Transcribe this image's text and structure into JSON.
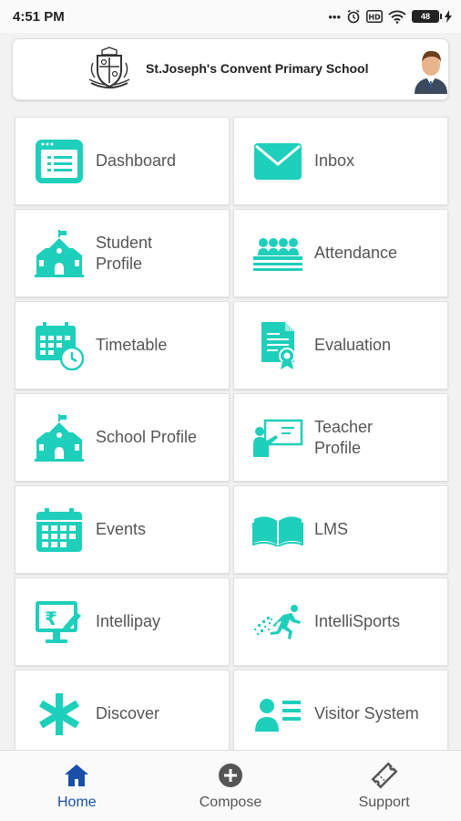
{
  "status_bar": {
    "time": "4:51 PM",
    "battery": "48",
    "icons": [
      "dots-icon",
      "alarm-icon",
      "hd-icon",
      "wifi-icon",
      "battery-icon",
      "charging-icon"
    ]
  },
  "header": {
    "school_name": "St.Joseph's Convent Primary School",
    "logo": "school-crest-icon",
    "avatar": "user-avatar-icon"
  },
  "colors": {
    "accent": "#1ecfbb",
    "nav_active": "#1a4fa8",
    "text": "#555555"
  },
  "tiles": [
    {
      "label": "Dashboard",
      "icon": "dashboard-icon"
    },
    {
      "label": "Inbox",
      "icon": "envelope-icon"
    },
    {
      "label": "Student\nProfile",
      "icon": "school-building-icon"
    },
    {
      "label": "Attendance",
      "icon": "classroom-icon"
    },
    {
      "label": "Timetable",
      "icon": "calendar-clock-icon"
    },
    {
      "label": "Evaluation",
      "icon": "certificate-icon"
    },
    {
      "label": "School Profile",
      "icon": "school-building-icon"
    },
    {
      "label": "Teacher\nProfile",
      "icon": "teacher-board-icon"
    },
    {
      "label": "Events",
      "icon": "calendar-icon"
    },
    {
      "label": "LMS",
      "icon": "open-book-icon"
    },
    {
      "label": "Intellipay",
      "icon": "rupee-monitor-icon"
    },
    {
      "label": "IntelliSports",
      "icon": "runner-icon"
    },
    {
      "label": "Discover",
      "icon": "asterisk-icon"
    },
    {
      "label": "Visitor System",
      "icon": "visitor-card-icon"
    }
  ],
  "bottom_nav": [
    {
      "label": "Home",
      "icon": "home-icon",
      "active": true
    },
    {
      "label": "Compose",
      "icon": "plus-circle-icon",
      "active": false
    },
    {
      "label": "Support",
      "icon": "ticket-icon",
      "active": false
    }
  ]
}
